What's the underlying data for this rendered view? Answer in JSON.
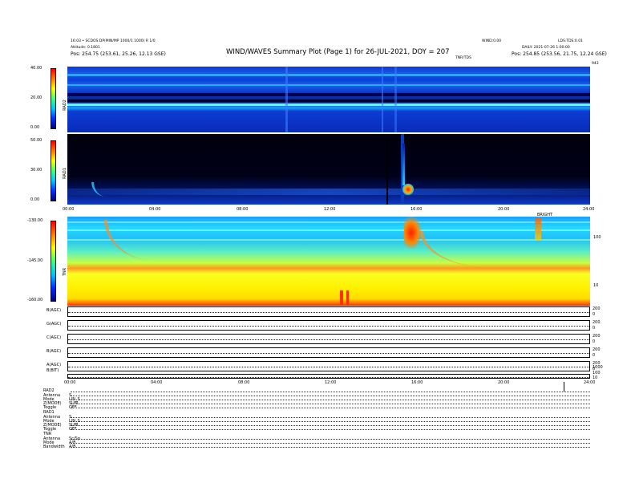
{
  "header": {
    "left_line1": "16:03 • SCDOS:DP(MIN/MP 1000/1 1000) R 1/0",
    "left_line2": "Attitude: 0.1801",
    "left_pos": "Pos: 254.75 (253.61, 25.26, 12.13 GSE)",
    "title": "WIND/WAVES Summary Plot (Page 1) for 26-JUL-2021, DOY = 207",
    "right_top": "WIND:0.00",
    "right_top2": "LDS:TDS:0.01",
    "right_line2": "DAILY: 2021-07-26 1:00:00",
    "right_pos": "Pos: 254.85 (253.56, 21.75, 12.24 GSE)",
    "tnr_label": "TNR/TDS",
    "rad2_top_right": "943"
  },
  "panels": {
    "rad2": {
      "label": "RAD2",
      "ticks": [
        "40.00",
        "20.00",
        "0.00"
      ]
    },
    "rad1": {
      "label": "RAD1",
      "ticks": [
        "50.00",
        "30.00",
        "0.00"
      ]
    },
    "tnr": {
      "label": "TNR",
      "ticks": [
        "-130.00",
        "-145.00",
        "-160.00"
      ],
      "right_ticks": [
        "100",
        "10"
      ],
      "marker": "BRIGHT"
    }
  },
  "time_axis": [
    "00:00",
    "04:00",
    "08:00",
    "12:00",
    "16:00",
    "20:00",
    "24:00"
  ],
  "aux_panels": [
    {
      "label": "B(AGC)",
      "right": [
        "200",
        "0"
      ]
    },
    {
      "label": "G(AGC)",
      "right": [
        "200",
        "0"
      ]
    },
    {
      "label": "C(AGC)",
      "right": [
        "200",
        "0"
      ]
    },
    {
      "label": "B(AGC)",
      "right": [
        "200",
        "0"
      ]
    },
    {
      "label": "A(AGC)",
      "right": [
        "200",
        "0"
      ]
    },
    {
      "label": "B(BIT)",
      "right": [
        "1000",
        "100",
        "10"
      ]
    }
  ],
  "modes": {
    "rad2_title": "RAD2",
    "rad2_rows": [
      {
        "key": "Antenna",
        "val": "S"
      },
      {
        "key": "Mode",
        "val": "LIN_S"
      },
      {
        "key": "Z(MODE)",
        "val": "SUM"
      },
      {
        "key": "Toggle",
        "val": "OFF"
      }
    ],
    "rad1_title": "RAD1",
    "rad1_rows": [
      {
        "key": "Antenna",
        "val": "S"
      },
      {
        "key": "Mode",
        "val": "LIN_S"
      },
      {
        "key": "Z(MODE)",
        "val": "SUM"
      },
      {
        "key": "Toggle",
        "val": "OFF"
      }
    ],
    "tnr_title": "TNR",
    "tnr_rows": [
      {
        "key": "Antenna",
        "val": "Sc/Sp"
      },
      {
        "key": "Mode",
        "val": "A/B"
      },
      {
        "key": "Bandwidth",
        "val": "A/B"
      }
    ]
  },
  "chart_data": {
    "type": "heatmap",
    "title": "WIND/WAVES Summary Plot (Page 1) for 26-JUL-2021, DOY = 207",
    "x_range_hours": [
      0,
      24
    ],
    "panels": [
      {
        "name": "RAD2",
        "y_range": [
          0,
          40
        ],
        "events_hours": [
          10,
          14.2,
          16.3
        ]
      },
      {
        "name": "RAD1",
        "y_range": [
          0,
          50
        ],
        "events_hours": [
          1.5,
          15.0
        ]
      },
      {
        "name": "TNR",
        "y_range": [
          -160,
          -130
        ],
        "events_hours": [
          1.5,
          15.7,
          21.5
        ]
      }
    ],
    "colors": {
      "low": "#00007a",
      "mid": "#00e0ff",
      "high": "#ff3000"
    }
  }
}
